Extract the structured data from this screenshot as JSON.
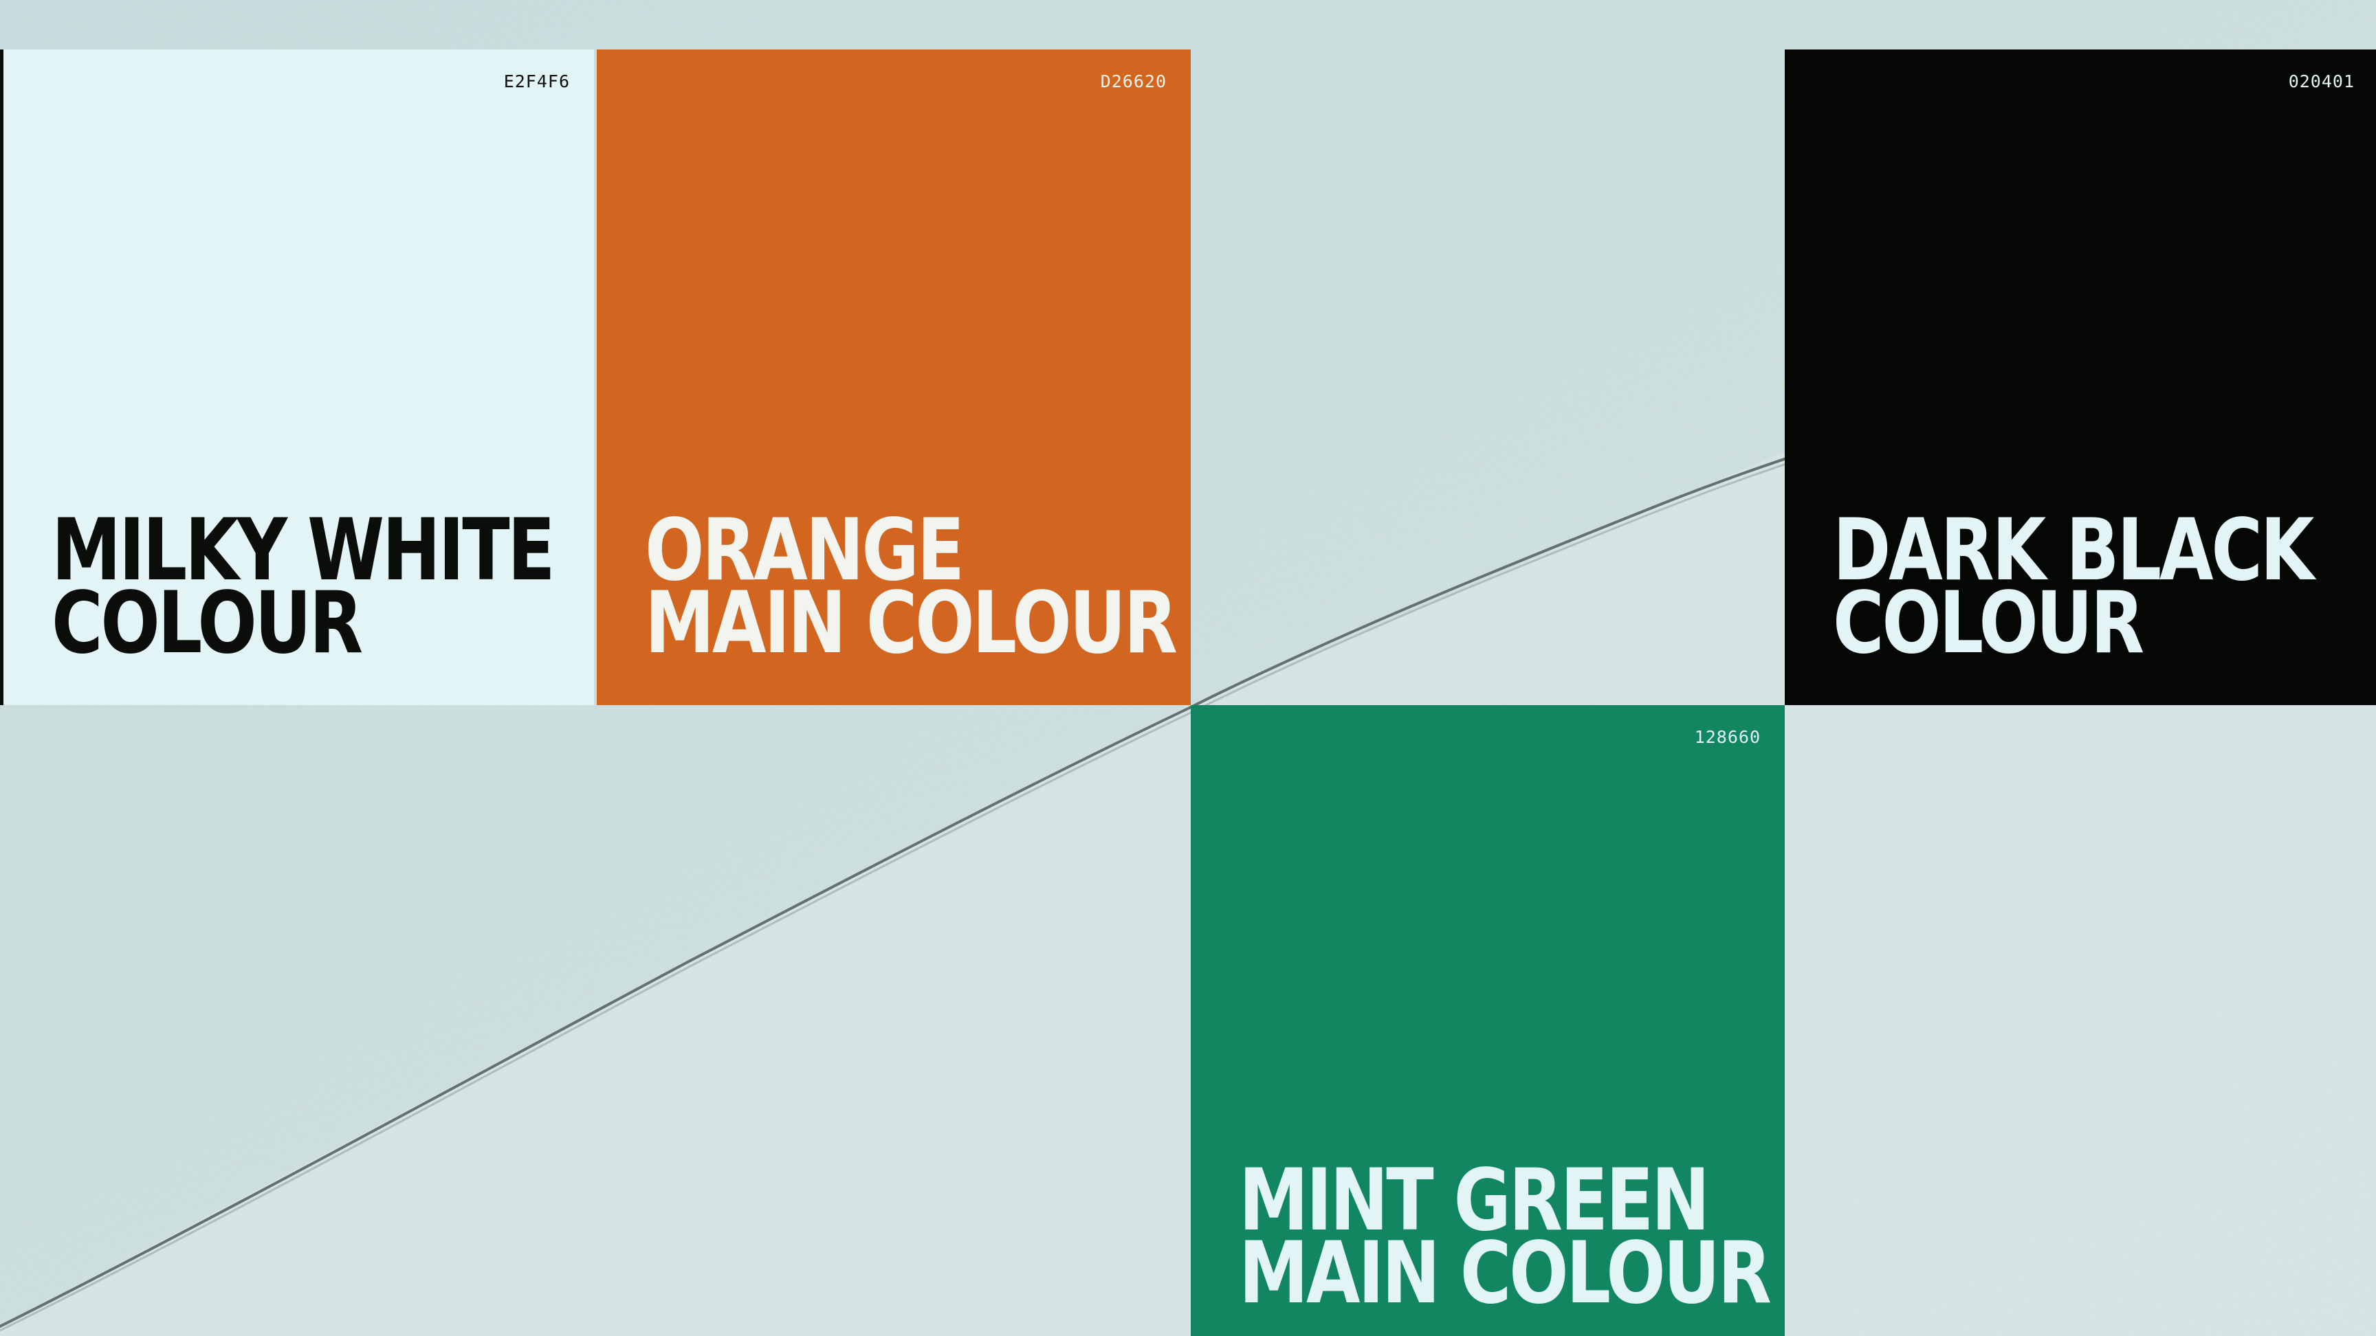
{
  "colors": {
    "background_paper": "#D3E3E4",
    "tear_line": "#5F6B6C"
  },
  "swatches": [
    {
      "id": "milky-white",
      "hex_label": "E2F4F6",
      "fill": "#E2F4F6",
      "text_color": "#0B0D0A",
      "name_line1": "MILKY WHITE",
      "name_line2": "COLOUR"
    },
    {
      "id": "orange",
      "hex_label": "D26620",
      "fill": "#D26620",
      "text_color": "#F2F4F0",
      "name_line1": "ORANGE",
      "name_line2": "MAIN COLOUR"
    },
    {
      "id": "dark-black",
      "hex_label": "020401",
      "fill": "#050705",
      "text_color": "#E2F4F6",
      "name_line1": "DARK BLACK",
      "name_line2": "COLOUR"
    },
    {
      "id": "mint-green",
      "hex_label": "128660",
      "fill": "#128660",
      "text_color": "#E2F4F6",
      "name_line1": "MINT GREEN",
      "name_line2": "MAIN COLOUR"
    }
  ]
}
